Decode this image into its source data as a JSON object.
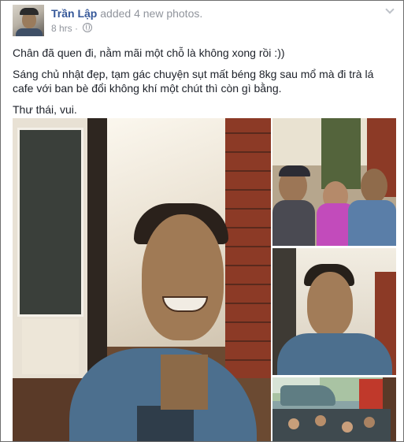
{
  "post": {
    "author": "Trần Lập",
    "action": "added 4 new photos.",
    "timestamp": "8 hrs",
    "separator": "·",
    "privacy_icon": "globe-icon",
    "options_icon": "chevron-down-icon",
    "text_lines": [
      "Chân đã quen đi, nằm mãi một chỗ là không xong rồi :))",
      "Sáng chủ nhật đẹp, tạm gác chuyện sụt mất béng 8kg sau mổ mà đi trà lá cafe với ban bè đổi không khí một chút thì còn gì bằng.",
      "Thư thái, vui."
    ],
    "photos_count": 4
  },
  "colors": {
    "author_link": "#365899",
    "meta_text": "#90949c",
    "body_text": "#1d2129",
    "card_border": "#6f6f6f"
  }
}
